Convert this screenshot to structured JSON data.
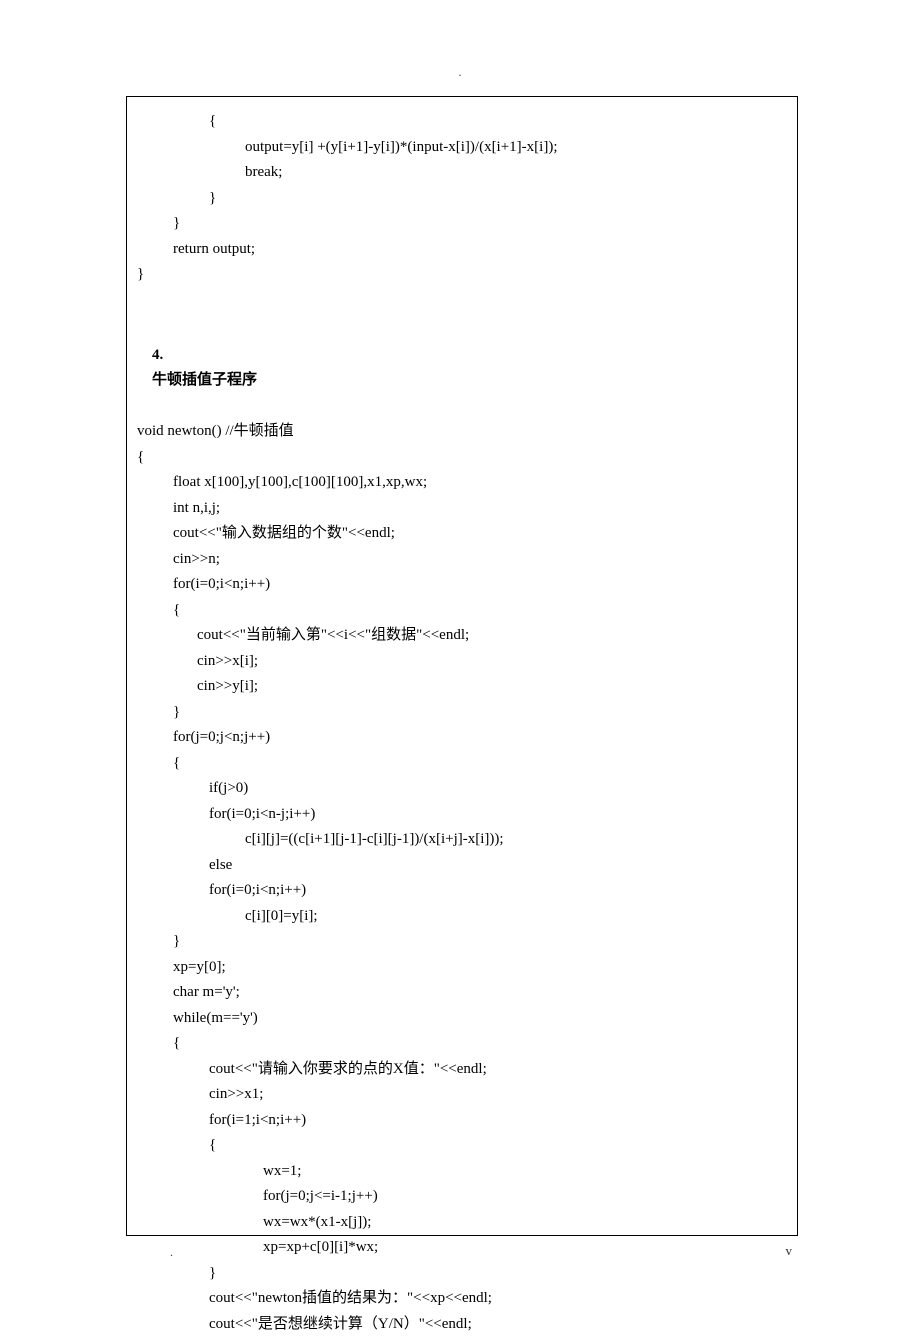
{
  "top_marker": ".",
  "segment1": {
    "lines": [
      {
        "cls": "indent2",
        "text": "{"
      },
      {
        "cls": "indent3",
        "text": "output=y[i] +(y[i+1]-y[i])*(input-x[i])/(x[i+1]-x[i]);"
      },
      {
        "cls": "indent3",
        "text": "break;"
      },
      {
        "cls": "indent2",
        "text": "}"
      },
      {
        "cls": "indent1",
        "text": "}"
      },
      {
        "cls": "indent1",
        "text": "return output;"
      },
      {
        "cls": "",
        "text": "}"
      }
    ]
  },
  "heading": {
    "num": "4.",
    "title": "牛顿插值子程序"
  },
  "segment2": {
    "lines": [
      {
        "cls": "",
        "text": "void newton() //牛顿插值"
      },
      {
        "cls": "",
        "text": "{"
      },
      {
        "cls": "indent1",
        "text": "float x[100],y[100],c[100][100],x1,xp,wx;"
      },
      {
        "cls": "indent1",
        "text": "int n,i,j;"
      },
      {
        "cls": "indent1",
        "text": "cout<<\"输入数据组的个数\"<<endl;"
      },
      {
        "cls": "indent1",
        "text": "cin>>n;"
      },
      {
        "cls": "indent1",
        "text": "for(i=0;i<n;i++)"
      },
      {
        "cls": "indent1",
        "text": "{"
      },
      {
        "cls": "indent2b",
        "text": "cout<<\"当前输入第\"<<i<<\"组数据\"<<endl;"
      },
      {
        "cls": "indent2b",
        "text": "cin>>x[i];"
      },
      {
        "cls": "indent2b",
        "text": "cin>>y[i];"
      },
      {
        "cls": "indent1",
        "text": "}"
      },
      {
        "cls": "indent1",
        "text": "for(j=0;j<n;j++)"
      },
      {
        "cls": "indent1",
        "text": "{"
      },
      {
        "cls": "indent2",
        "text": "if(j>0)"
      },
      {
        "cls": "indent2",
        "text": "for(i=0;i<n-j;i++)"
      },
      {
        "cls": "indent3",
        "text": "c[i][j]=((c[i+1][j-1]-c[i][j-1])/(x[i+j]-x[i]));"
      },
      {
        "cls": "indent2",
        "text": "else"
      },
      {
        "cls": "indent2",
        "text": "for(i=0;i<n;i++)"
      },
      {
        "cls": "indent3",
        "text": "c[i][0]=y[i];"
      },
      {
        "cls": "indent1",
        "text": "}"
      },
      {
        "cls": "indent1",
        "text": "xp=y[0];"
      },
      {
        "cls": "indent1",
        "text": "char m='y';"
      },
      {
        "cls": "indent1",
        "text": "while(m=='y')"
      },
      {
        "cls": "indent1",
        "text": "{"
      },
      {
        "cls": "indent2",
        "text": "cout<<\"请输入你要求的点的X值：\"<<endl;"
      },
      {
        "cls": "indent2",
        "text": "cin>>x1;"
      },
      {
        "cls": "indent2",
        "text": "for(i=1;i<n;i++)"
      },
      {
        "cls": "indent2",
        "text": "{"
      },
      {
        "cls": "indent4",
        "text": "wx=1;"
      },
      {
        "cls": "indent4",
        "text": "for(j=0;j<=i-1;j++)"
      },
      {
        "cls": "indent4",
        "text": "wx=wx*(x1-x[j]);"
      },
      {
        "cls": "indent4",
        "text": "xp=xp+c[0][i]*wx;"
      },
      {
        "cls": "indent2",
        "text": "}"
      },
      {
        "cls": "indent2",
        "text": "cout<<\"newton插值的结果为：\"<<xp<<endl;"
      },
      {
        "cls": "indent2",
        "text": "cout<<\"是否想继续计算（Y/N）\"<<endl;"
      }
    ]
  },
  "footer": {
    "left": ".",
    "right": "v"
  }
}
